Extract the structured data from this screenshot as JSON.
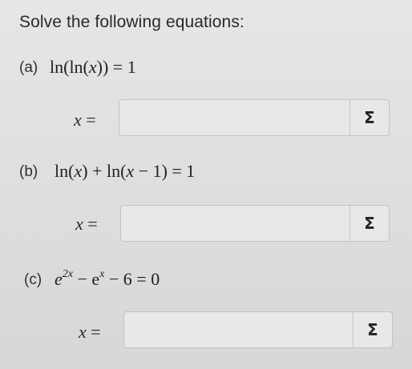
{
  "heading": "Solve the following equations:",
  "parts": [
    {
      "label": "(a)",
      "equation_parts": [
        "ln(ln(",
        "x",
        ")) = 1"
      ],
      "answer_prefix_var": "x",
      "answer_prefix_eq": " =",
      "answer_value": "",
      "symbol_button": "Σ"
    },
    {
      "label": "(b)",
      "equation_parts": [
        "ln(",
        "x",
        ") + ln(",
        "x",
        " − 1) = 1"
      ],
      "answer_prefix_var": "x",
      "answer_prefix_eq": " =",
      "answer_value": "",
      "symbol_button": "Σ"
    },
    {
      "label": "(c)",
      "equation_parts": [
        "e",
        "2x",
        " − e",
        "x",
        " − 6 = 0"
      ],
      "answer_prefix_var": "x",
      "answer_prefix_eq": " =",
      "answer_value": "",
      "symbol_button": "Σ"
    }
  ]
}
